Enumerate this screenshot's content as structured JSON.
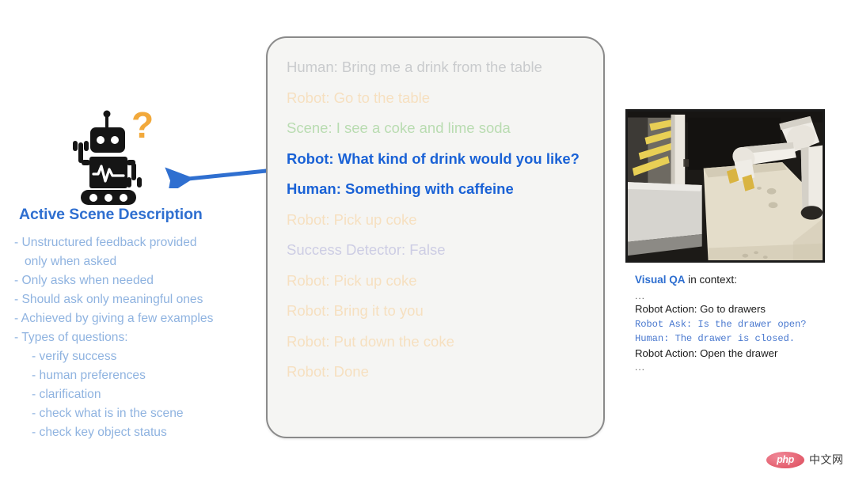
{
  "left": {
    "heading": "Active Scene Description",
    "robot_icon": "robot-with-question-mark-icon",
    "bullets": [
      {
        "text": "- Unstructured feedback provided",
        "indent": false
      },
      {
        "text": "   only when asked",
        "indent": false
      },
      {
        "text": "- Only asks when needed",
        "indent": false
      },
      {
        "text": "- Should ask only meaningful ones",
        "indent": false
      },
      {
        "text": "- Achieved by giving a few examples",
        "indent": false
      },
      {
        "text": "- Types of questions:",
        "indent": false
      },
      {
        "text": "- verify success",
        "indent": true
      },
      {
        "text": "- human preferences",
        "indent": true
      },
      {
        "text": "- clarification",
        "indent": true
      },
      {
        "text": "- check what is in the scene",
        "indent": true
      },
      {
        "text": "- check key object status",
        "indent": true
      }
    ]
  },
  "arrow": {
    "name": "arrow-pointing-left",
    "color": "#2f6fd0"
  },
  "dialogue": {
    "lines": [
      {
        "text": "Human: Bring me a drink from the table",
        "tone": "grey"
      },
      {
        "text": "Robot: Go to the table",
        "tone": "orange"
      },
      {
        "text": "Scene: I see a coke and lime soda",
        "tone": "green"
      },
      {
        "text": "Robot: What kind of drink would you like?",
        "tone": "blue"
      },
      {
        "text": "Human: Something with caffeine",
        "tone": "blue"
      },
      {
        "text": "Robot: Pick up coke",
        "tone": "orange"
      },
      {
        "text": "Success Detector: False",
        "tone": "purple"
      },
      {
        "text": "Robot: Pick up coke",
        "tone": "orange"
      },
      {
        "text": "Robot: Bring it to you",
        "tone": "orange"
      },
      {
        "text": "Robot: Put down the coke",
        "tone": "orange"
      },
      {
        "text": "Robot: Done",
        "tone": "orange"
      }
    ]
  },
  "right": {
    "photo_caption": "robot-arm-at-table-photo",
    "qa_title_strong": "Visual QA",
    "qa_title_rest": " in context:",
    "qa_lines": [
      {
        "text": "...",
        "style": "ellipsis"
      },
      {
        "text": "Robot Action: Go to drawers",
        "style": "plain"
      },
      {
        "text": "Robot Ask: Is the drawer open?",
        "style": "mono"
      },
      {
        "text": "Human: The drawer is closed.",
        "style": "mono"
      },
      {
        "text": "Robot Action: Open the drawer",
        "style": "plain"
      },
      {
        "text": "...",
        "style": "ellipsis"
      }
    ]
  },
  "watermark": {
    "badge_label": "php",
    "text": "中文网"
  },
  "colors": {
    "accent_blue": "#2f6fd0",
    "dialogue_blue": "#1a62d6",
    "bullet_blue": "#8fb3e0",
    "robot_question": "#f2a93b",
    "box_border": "#8a8a8a",
    "box_fill": "#f5f5f3"
  }
}
